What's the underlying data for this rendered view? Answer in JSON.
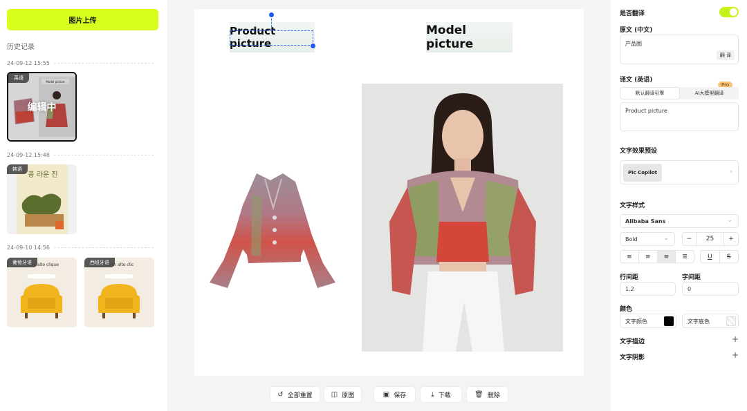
{
  "sidebar": {
    "upload_label": "图片上传",
    "history_title": "历史记录",
    "groups": [
      {
        "date": "24-09-12 15:55",
        "items": [
          {
            "tag": "英语",
            "overlay": "编辑中",
            "mini_text": "Model picture"
          }
        ]
      },
      {
        "date": "24-09-12 15:48",
        "items": [
          {
            "tag": "韩语",
            "mini_text": "풍 라운 진"
          }
        ]
      },
      {
        "date": "24-09-10 14:56",
        "items": [
          {
            "tag": "葡萄牙语",
            "mini_text": "sém alto clique"
          },
          {
            "tag": "西班牙语",
            "mini_text": "mén alto clic"
          }
        ]
      }
    ]
  },
  "canvas": {
    "product_label": "Product picture",
    "model_label": "Model picture"
  },
  "toolbar": {
    "reset": "全部重置",
    "original": "原图",
    "save": "保存",
    "download": "下载",
    "delete": "删除"
  },
  "panel": {
    "translate_label": "是否翻译",
    "translate_on": true,
    "source_label": "原文 (中文)",
    "source_text": "产品图",
    "translate_btn": "翻 译",
    "target_label": "译文 (英语)",
    "pro_badge": "Pro",
    "tabs": [
      "默认翻译引擎",
      "AI大模型翻译"
    ],
    "target_text": "Product picture",
    "preset_label": "文字效果预设",
    "preset_value": "Pic Copilot",
    "style_label": "文字样式",
    "font_family": "Alibaba Sans",
    "font_weight": "Bold",
    "font_size": "25",
    "line_spacing_label": "行间距",
    "line_spacing": "1.2",
    "letter_spacing_label": "字间距",
    "letter_spacing": "0",
    "color_label": "颜色",
    "text_color_label": "文字颜色",
    "bg_color_label": "文字底色",
    "stroke_label": "文字描边",
    "shadow_label": "文字阴影"
  },
  "colors": {
    "accent": "#d7ff1e",
    "selection": "#1a5cf0",
    "text_color": "#000000"
  }
}
